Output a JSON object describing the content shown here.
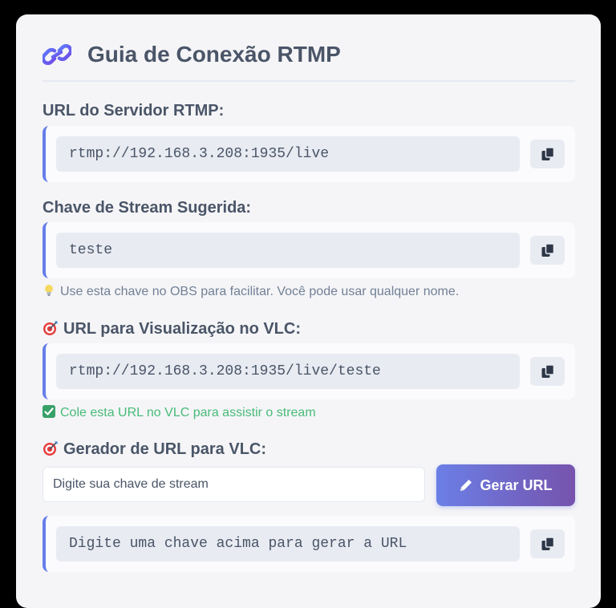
{
  "title": "Guia de Conexão RTMP",
  "colors": {
    "accent": "#667eea",
    "accent_gradient_end": "#7653ad",
    "text": "#4a5568",
    "hint_gray": "#718096",
    "hint_green": "#48bb78"
  },
  "rtmp_server": {
    "label": "URL do Servidor RTMP:",
    "value": "rtmp://192.168.3.208:1935/live",
    "copy_icon": "copy-icon"
  },
  "stream_key": {
    "label": "Chave de Stream Sugerida:",
    "value": "teste",
    "copy_icon": "copy-icon",
    "hint": "Use esta chave no OBS para facilitar. Você pode usar qualquer nome.",
    "hint_icon": "lightbulb-icon"
  },
  "vlc_url": {
    "label": "URL para Visualização no VLC:",
    "label_icon": "target-icon",
    "value": "rtmp://192.168.3.208:1935/live/teste",
    "copy_icon": "copy-icon",
    "hint": "Cole esta URL no VLC para assistir o stream",
    "hint_icon": "checkmark-icon"
  },
  "generator": {
    "label": "Gerador de URL para VLC:",
    "label_icon": "target-icon",
    "input_placeholder": "Digite sua chave de stream",
    "input_value": "",
    "button_label": "Gerar URL",
    "button_icon": "pencil-icon",
    "result": "Digite uma chave acima para gerar a URL",
    "copy_icon": "copy-icon"
  }
}
